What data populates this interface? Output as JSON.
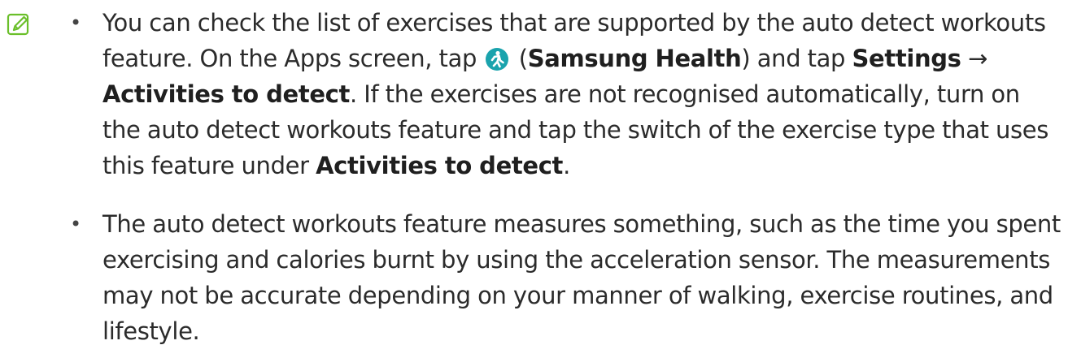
{
  "icons": {
    "note": "note-pencil-icon",
    "samsung_health": "samsung-health-icon",
    "arrow": "arrow-right-icon"
  },
  "colors": {
    "text": "#2b2b2b",
    "icon_stroke": "#6abf2a",
    "samsung_health_bg": "#1aa3ad",
    "samsung_health_fg": "#ffffff"
  },
  "notes": [
    {
      "text_1": "You can check the list of exercises that are supported by the auto detect workouts feature. On the Apps screen, tap ",
      "text_2": " (",
      "app_name": "Samsung Health",
      "text_3": ") and tap ",
      "menu_settings": "Settings",
      "arrow": "→",
      "menu_activities": "Activities to detect",
      "text_4": ". If the exercises are not recognised automatically, turn on the auto detect workouts feature and tap the switch of the exercise type that uses this feature under ",
      "menu_activities_2": "Activities to detect",
      "text_5": "."
    },
    {
      "text": "The auto detect workouts feature measures something, such as the time you spent exercising and calories burnt by using the acceleration sensor. The measurements may not be accurate depending on your manner of walking, exercise routines, and lifestyle."
    }
  ],
  "bullet": "•"
}
